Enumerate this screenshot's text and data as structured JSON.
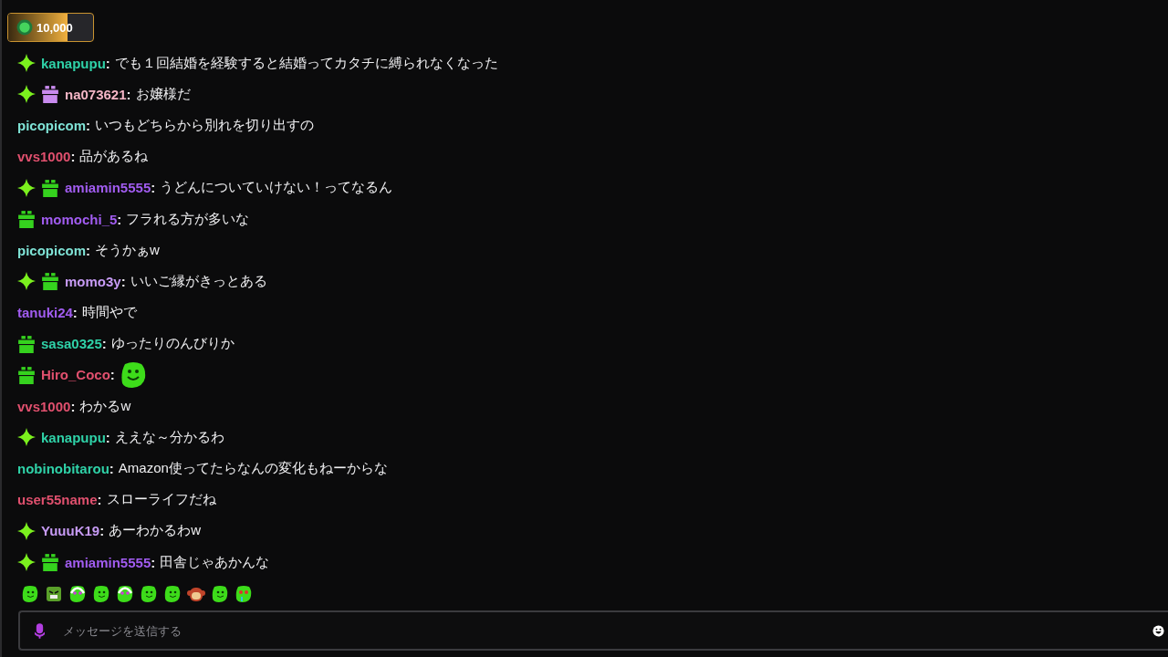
{
  "points": {
    "value": "10,000",
    "level": 0.7
  },
  "messages": [
    {
      "badges": [
        {
          "kind": "sparkle"
        }
      ],
      "user": "kanapupu",
      "separator": ":",
      "color": "#2fd2a8",
      "kind": "text",
      "text": "でも１回結婚を経験すると結婚ってカタチに縛られなくなった"
    },
    {
      "badges": [
        {
          "kind": "sparkle"
        },
        {
          "kind": "gift",
          "color": "#c98bef"
        }
      ],
      "user": "na073621",
      "separator": ":",
      "color": "#f4b6c6",
      "kind": "text",
      "text": "お嬢様だ"
    },
    {
      "user": "picopicom",
      "separator": ":",
      "color": "#7fe3d6",
      "kind": "text",
      "text": "いつもどちらから別れを切り出すの"
    },
    {
      "user": "vvs1000",
      "separator": ":",
      "color": "#e0506e",
      "kind": "text",
      "text": "品があるね"
    },
    {
      "badges": [
        {
          "kind": "sparkle"
        },
        {
          "kind": "gift",
          "color": "#35d21e"
        }
      ],
      "user": "amiamin5555",
      "separator": ":",
      "color": "#a15cf0",
      "kind": "text",
      "text": "うどんについていけない！ってなるん"
    },
    {
      "badges": [
        {
          "kind": "gift",
          "color": "#35d21e"
        }
      ],
      "user": "momochi_5",
      "separator": ":",
      "color": "#a15cf0",
      "kind": "text",
      "text": "フラれる方が多いな"
    },
    {
      "user": "picopicom",
      "separator": ":",
      "color": "#7fe3d6",
      "kind": "text",
      "text": "そうかぁw"
    },
    {
      "badges": [
        {
          "kind": "sparkle"
        },
        {
          "kind": "gift",
          "color": "#35d21e"
        }
      ],
      "user": "momo3y",
      "separator": ":",
      "color": "#c79bf5",
      "kind": "text",
      "text": "いいご縁がきっとある"
    },
    {
      "user": "tanuki24",
      "separator": ":",
      "color": "#a15cf0",
      "kind": "text",
      "text": "時間やで"
    },
    {
      "badges": [
        {
          "kind": "gift",
          "color": "#35d21e"
        }
      ],
      "user": "sasa0325",
      "separator": ":",
      "color": "#2fd2a8",
      "kind": "text",
      "text": "ゆったりのんびりか"
    },
    {
      "badges": [
        {
          "kind": "gift",
          "color": "#35d21e"
        }
      ],
      "user": "Hiro_Coco",
      "separator": ":",
      "color": "#e0506e",
      "kind": "emote"
    },
    {
      "user": "vvs1000",
      "separator": ":",
      "color": "#e0506e",
      "kind": "text",
      "text": "わかるw"
    },
    {
      "badges": [
        {
          "kind": "sparkle"
        }
      ],
      "user": "kanapupu",
      "separator": ":",
      "color": "#2fd2a8",
      "kind": "text",
      "text": "ええな～分かるわ"
    },
    {
      "user": "nobinobitarou",
      "separator": ":",
      "color": "#2fd2a8",
      "kind": "text",
      "text": "Amazon使ってたらなんの変化もねーからな"
    },
    {
      "user": "user55name",
      "separator": ":",
      "color": "#e0506e",
      "kind": "text",
      "text": "スローライフだね"
    },
    {
      "badges": [
        {
          "kind": "sparkle"
        }
      ],
      "user": "YuuuK19",
      "separator": ":",
      "color": "#c79bf5",
      "kind": "text",
      "text": "あーわかるわw"
    },
    {
      "badges": [
        {
          "kind": "sparkle"
        },
        {
          "kind": "gift",
          "color": "#35d21e"
        }
      ],
      "user": "amiamin5555",
      "separator": ":",
      "color": "#a15cf0",
      "kind": "text",
      "text": "田舎じゃあかんな"
    }
  ],
  "emotes": [
    {
      "kind": "blob"
    },
    {
      "kind": "angry"
    },
    {
      "kind": "headset"
    },
    {
      "kind": "blob"
    },
    {
      "kind": "headset"
    },
    {
      "kind": "blob"
    },
    {
      "kind": "blob"
    },
    {
      "kind": "monkey"
    },
    {
      "kind": "blob"
    },
    {
      "kind": "sick"
    }
  ],
  "input": {
    "placeholder": "メッセージを送信する"
  }
}
